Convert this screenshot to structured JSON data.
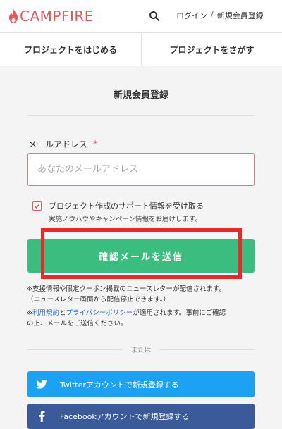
{
  "header": {
    "logo_text": "CAMPFIRE",
    "login_label": "ログイン",
    "separator": "/",
    "register_label": "新規会員登録"
  },
  "nav": {
    "tabs": [
      {
        "label": "プロジェクトをはじめる"
      },
      {
        "label": "プロジェクトをさがす"
      }
    ]
  },
  "form": {
    "title": "新規会員登録",
    "email_label": "メールアドレス",
    "required_mark": "*",
    "email_placeholder": "あなたのメールアドレス",
    "email_value": "",
    "checkbox_checked": true,
    "checkbox_label": "プロジェクト作成のサポート情報を受け取る",
    "checkbox_sub": "実施ノウハウやキャンペーン情報をお届けします。",
    "submit_label": "確認メールを送信"
  },
  "notes": {
    "note1_line1": "※支援情報や限定クーポン掲載のニュースレターが配信されます。",
    "note1_line2": "（ニュースレター画面から配信停止できます。）",
    "note2_prefix": "※",
    "terms_link": "利用規約",
    "and": "と",
    "privacy_link": "プライバシーポリシー",
    "note2_rest": "が適用されます。事前にご確認",
    "note2_line2": "の上、メールをご送信ください。"
  },
  "divider_text": "または",
  "social": {
    "twitter_label": "Twitterアカウントで新規登録する",
    "facebook_label": "Facebookアカウントで新規登録する"
  },
  "colors": {
    "brand": "#e8555a",
    "submit": "#3bbd80",
    "twitter": "#1da1f2",
    "facebook": "#3a5a99",
    "link": "#2a72c8",
    "highlight": "#e42b2b"
  }
}
